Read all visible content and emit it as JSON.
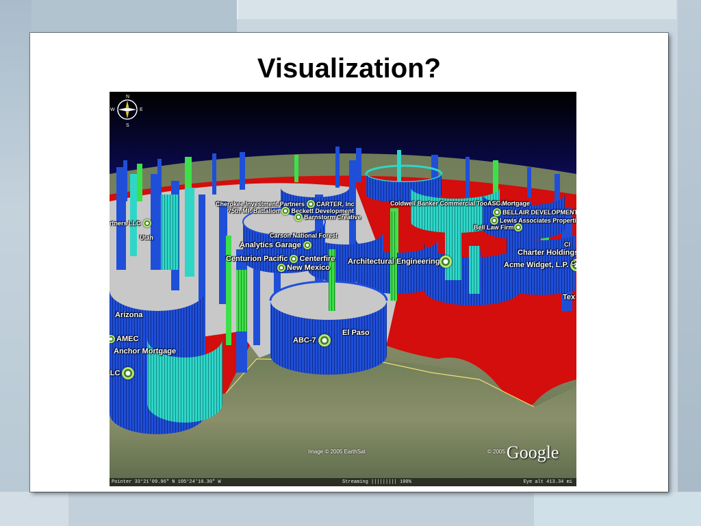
{
  "slide": {
    "title": "Visualization?"
  },
  "map": {
    "status": {
      "pointer": "Pointer 33°21'09.96\" N 105°24'10.30\" W",
      "streaming": "Streaming ||||||||| 100%",
      "eye_alt": "Eye alt 413.34 mi"
    },
    "copyright": "Image © 2005 EarthSat",
    "logo": {
      "year": "© 2005",
      "word": "Google"
    },
    "compass": {
      "n": "N",
      "s": "S",
      "e": "E",
      "w": "W"
    },
    "places": [
      {
        "label": "Cherokee Investment Partners"
      },
      {
        "label": "CARTER, Inc"
      },
      {
        "label": "75th MP Battalion"
      },
      {
        "label": "Beckett Development"
      },
      {
        "label": "Barnstorm Creative"
      },
      {
        "label": "rtners LLC"
      },
      {
        "label": "Utah"
      },
      {
        "label": "Carson National Forest"
      },
      {
        "label": "Analytics Garage"
      },
      {
        "label": "Centurion Pacific"
      },
      {
        "label": "Centerfire"
      },
      {
        "label": "New Mexico"
      },
      {
        "label": "Architectural Engineering"
      },
      {
        "label": "Coldwell Banker Commercial"
      },
      {
        "label": "Tood Realtors"
      },
      {
        "label": "ASC Mortgage"
      },
      {
        "label": "BELLAIR DEVELOPMENT GROUP"
      },
      {
        "label": "Lewis Associates Properties"
      },
      {
        "label": "Bell Law Firm"
      },
      {
        "label": "Charter Holdings"
      },
      {
        "label": "Acme Widget, L.P."
      },
      {
        "label": "Cl"
      },
      {
        "label": "C"
      },
      {
        "label": "Tex"
      },
      {
        "label": "Arizona"
      },
      {
        "label": "AMEC"
      },
      {
        "label": "Anchor Mortgage"
      },
      {
        "label": "LLC"
      },
      {
        "label": "ABC-7"
      },
      {
        "label": "El Paso"
      }
    ]
  },
  "colors": {
    "bar_blue": "#1f4fd8",
    "bar_cyan": "#2fd6c8",
    "bar_green": "#3ee04a",
    "region_red": "#d40d0d",
    "land_gray": "#c8c8c8",
    "sky_top": "#000000",
    "sky_horizon": "#3b2bd8"
  }
}
